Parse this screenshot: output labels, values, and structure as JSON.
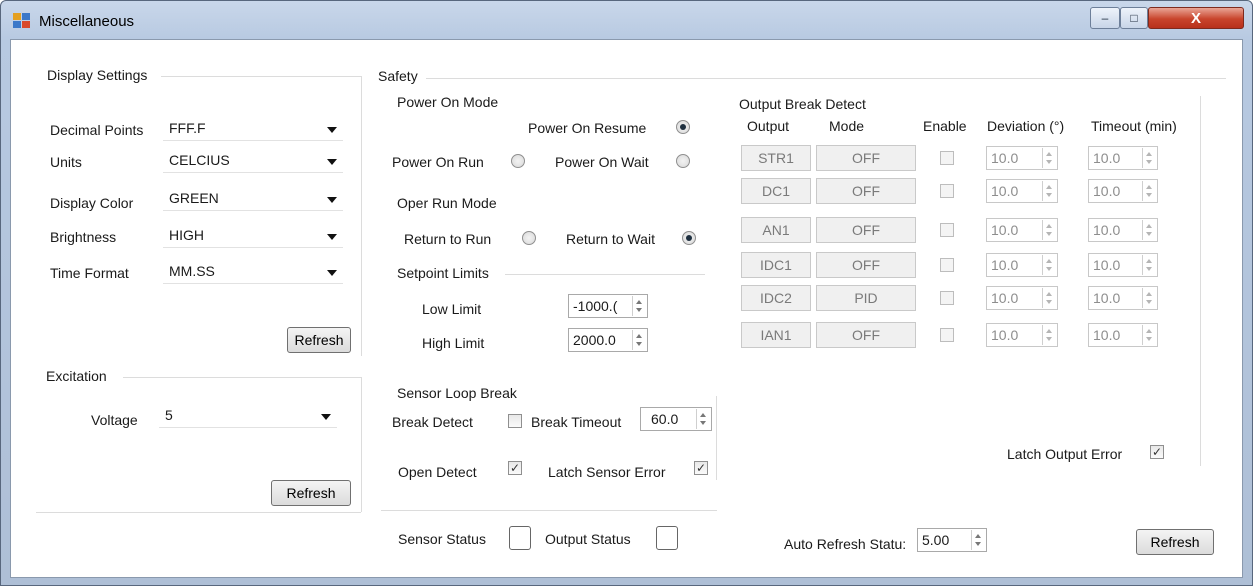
{
  "window": {
    "title": "Miscellaneous",
    "controls": {
      "minimize": "–",
      "maximize": "□",
      "close": "X"
    }
  },
  "display_settings": {
    "heading": "Display Settings",
    "rows": [
      {
        "label": "Decimal Points",
        "value": "FFF.F"
      },
      {
        "label": "Units",
        "value": "CELCIUS"
      },
      {
        "label": "Display Color",
        "value": "GREEN"
      },
      {
        "label": "Brightness",
        "value": "HIGH"
      },
      {
        "label": "Time Format",
        "value": "MM.SS"
      }
    ],
    "refresh_label": "Refresh"
  },
  "excitation": {
    "heading": "Excitation",
    "voltage_label": "Voltage",
    "voltage_value": "5",
    "refresh_label": "Refresh"
  },
  "safety": {
    "heading": "Safety",
    "power_on_mode": {
      "heading": "Power On Mode",
      "resume_label": "Power On Resume",
      "run_label": "Power On Run",
      "wait_label": "Power On Wait",
      "selected": "resume"
    },
    "oper_run_mode": {
      "heading": "Oper Run Mode",
      "run_label": "Return to  Run",
      "wait_label": "Return to Wait",
      "selected": "wait"
    },
    "setpoint_limits": {
      "heading": "Setpoint Limits",
      "low_label": "Low Limit",
      "low_value": "-1000.(",
      "high_label": "High Limit",
      "high_value": "2000.0"
    },
    "sensor_loop_break": {
      "heading": "Sensor Loop Break",
      "break_detect_label": "Break Detect",
      "break_detect_checked": false,
      "break_timeout_label": "Break Timeout",
      "break_timeout_value": "60.0",
      "open_detect_label": "Open Detect",
      "open_detect_checked": true,
      "latch_sensor_label": "Latch Sensor Error",
      "latch_sensor_checked": true
    }
  },
  "output_break_detect": {
    "heading": "Output Break Detect",
    "columns": [
      "Output",
      "Mode",
      "Enable",
      "Deviation (°)",
      "Timeout (min)"
    ],
    "rows": [
      {
        "output": "STR1",
        "mode": "OFF",
        "enabled": false,
        "deviation": "10.0",
        "timeout": "10.0"
      },
      {
        "output": "DC1",
        "mode": "OFF",
        "enabled": false,
        "deviation": "10.0",
        "timeout": "10.0"
      },
      {
        "output": "AN1",
        "mode": "OFF",
        "enabled": false,
        "deviation": "10.0",
        "timeout": "10.0"
      },
      {
        "output": "IDC1",
        "mode": "OFF",
        "enabled": false,
        "deviation": "10.0",
        "timeout": "10.0"
      },
      {
        "output": "IDC2",
        "mode": "PID",
        "enabled": false,
        "deviation": "10.0",
        "timeout": "10.0"
      },
      {
        "output": "IAN1",
        "mode": "OFF",
        "enabled": false,
        "deviation": "10.0",
        "timeout": "10.0"
      }
    ],
    "latch_output_label": "Latch Output Error",
    "latch_output_checked": true
  },
  "status": {
    "sensor_label": "Sensor Status",
    "output_label": "Output Status",
    "auto_refresh_label": "Auto Refresh Statu:",
    "auto_refresh_value": "5.00",
    "refresh_label": "Refresh"
  },
  "glyphs": {
    "check": "✓"
  }
}
